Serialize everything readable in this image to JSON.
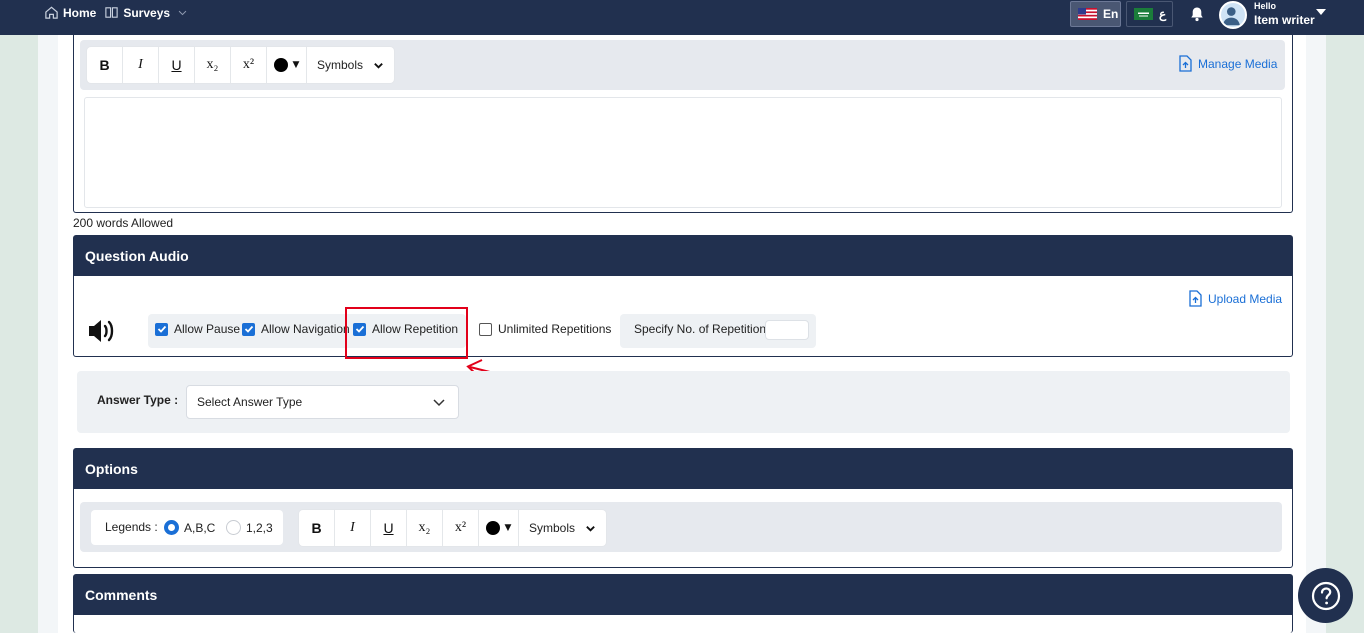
{
  "nav": {
    "home": "Home",
    "surveys": "Surveys",
    "lang_en": "En",
    "lang_ar": "ع",
    "hello": "Hello",
    "user": "Item writer"
  },
  "editor_top": {
    "toolbar": {
      "bold": "B",
      "italic": "I",
      "underline": "U",
      "subscript": "x₂",
      "superscript": "x²",
      "symbols": "Symbols"
    },
    "manage_media": "Manage Media",
    "words_allowed": "200 words Allowed"
  },
  "question_audio": {
    "title": "Question Audio",
    "upload_media": "Upload Media",
    "options": [
      {
        "label": "Allow Pause",
        "checked": true
      },
      {
        "label": "Allow Navigation",
        "checked": true
      },
      {
        "label": "Allow Repetition",
        "checked": true
      },
      {
        "label": "Unlimited Repetitions",
        "checked": false
      }
    ],
    "specify_label": "Specify No. of Repetitions",
    "specify_value": ""
  },
  "answer": {
    "label": "Answer Type :",
    "placeholder": "Select Answer Type"
  },
  "options_panel": {
    "title": "Options",
    "legends_label": "Legends :",
    "legend_options": [
      {
        "label": "A,B,C",
        "selected": true
      },
      {
        "label": "1,2,3",
        "selected": false
      }
    ],
    "toolbar": {
      "bold": "B",
      "italic": "I",
      "underline": "U",
      "subscript": "x₂",
      "superscript": "x²",
      "symbols": "Symbols"
    }
  },
  "comments_panel": {
    "title": "Comments"
  },
  "colors": {
    "navy": "#21304f",
    "accent": "#1a6fd6",
    "highlight": "#e2001a"
  }
}
